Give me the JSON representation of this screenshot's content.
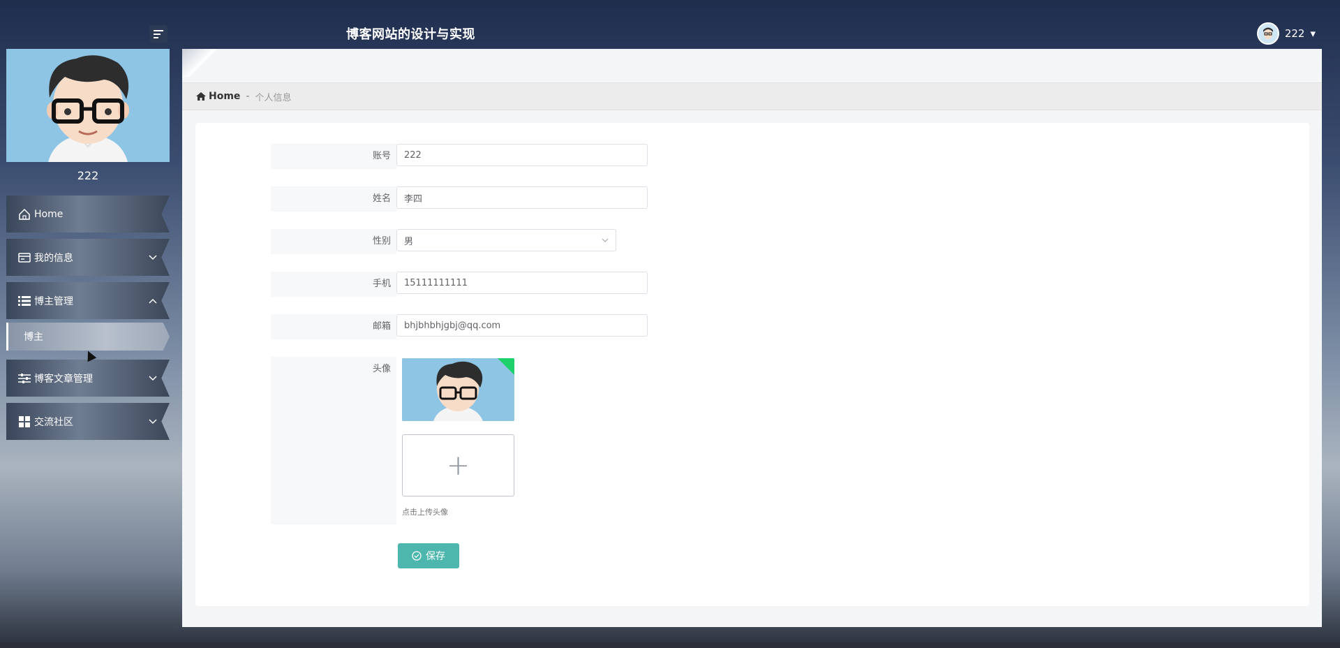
{
  "header": {
    "site_title": "博客网站的设计与实现",
    "menu_icon": "menu-lines-icon",
    "user_name": "222",
    "user_caret": "▾"
  },
  "sidebar": {
    "profile_name": "222",
    "items": [
      {
        "label": "Home",
        "icon": "home-icon",
        "chevron": ""
      },
      {
        "label": "我的信息",
        "icon": "id-card-icon",
        "chevron": "⌄"
      },
      {
        "label": "博主管理",
        "icon": "list-icon",
        "chevron": "⌃",
        "children": [
          {
            "label": "博主"
          }
        ]
      },
      {
        "label": "博客文章管理",
        "icon": "sliders-icon",
        "chevron": "⌄"
      },
      {
        "label": "交流社区",
        "icon": "grid-icon",
        "chevron": "⌄"
      }
    ]
  },
  "breadcrumb": {
    "home": "Home",
    "separator": "-",
    "current": "个人信息"
  },
  "form": {
    "account": {
      "label": "账号",
      "value": "222"
    },
    "name": {
      "label": "姓名",
      "value": "李四"
    },
    "gender": {
      "label": "性别",
      "value": "男"
    },
    "phone": {
      "label": "手机",
      "value": "15111111111"
    },
    "email": {
      "label": "邮箱",
      "value": "bhjbhbhjgbj@qq.com"
    },
    "avatar": {
      "label": "头像",
      "upload_hint": "点击上传头像",
      "plus": "+"
    },
    "save_label": "保存"
  },
  "colors": {
    "accent": "#4db7ae",
    "header_bg": "#1f2d4d",
    "upload_badge": "#1ed06a"
  }
}
